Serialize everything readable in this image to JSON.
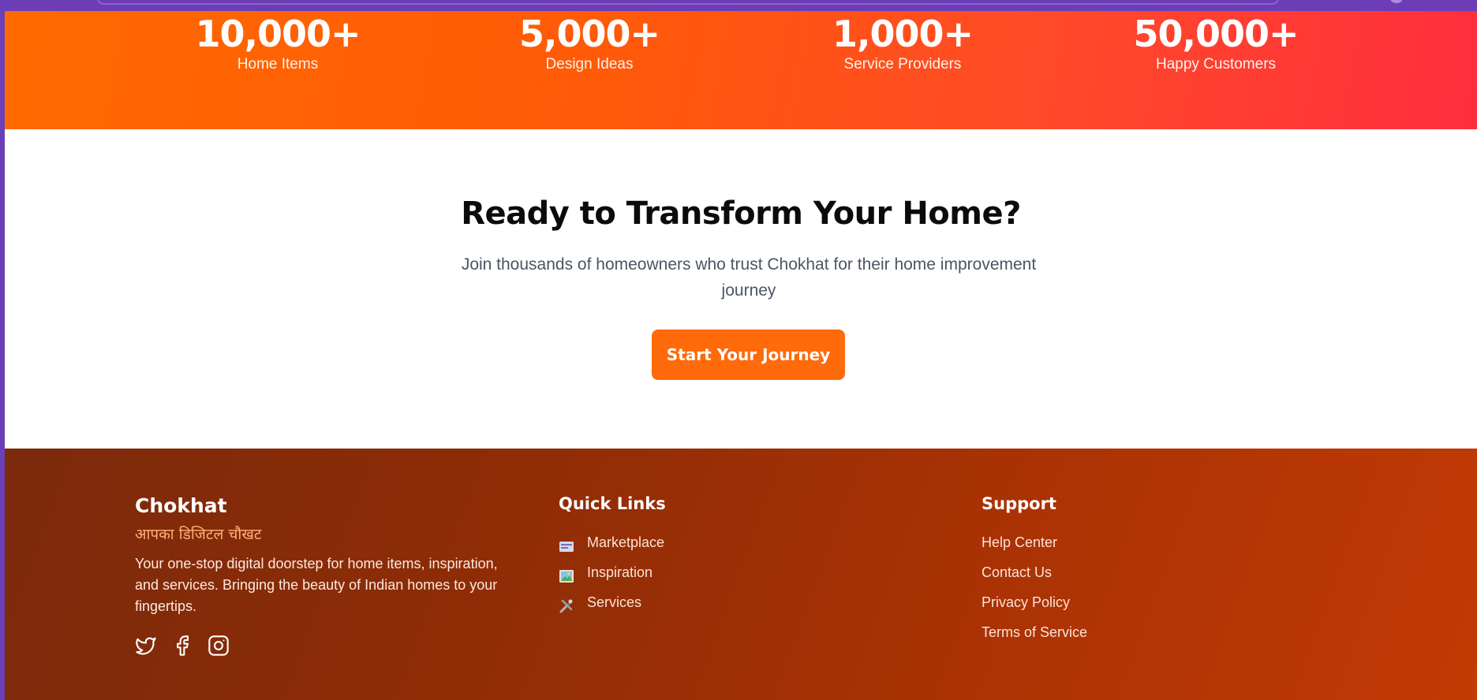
{
  "stats": [
    {
      "value": "10,000+",
      "label": "Home Items"
    },
    {
      "value": "5,000+",
      "label": "Design Ideas"
    },
    {
      "value": "1,000+",
      "label": "Service Providers"
    },
    {
      "value": "50,000+",
      "label": "Happy Customers"
    }
  ],
  "cta": {
    "title": "Ready to Transform Your Home?",
    "subtitle": "Join thousands of homeowners who trust Chokhat for their home improvement journey",
    "button": "Start Your Journey"
  },
  "footer": {
    "brand": {
      "name": "Chokhat",
      "tagline": "आपका डिजिटल चौखट",
      "description": "Your one-stop digital doorstep for home items, inspiration, and services. Bringing the beauty of Indian homes to your fingertips."
    },
    "social_icons": [
      "twitter-icon",
      "facebook-icon",
      "instagram-icon"
    ],
    "quick_links": {
      "title": "Quick Links",
      "items": [
        {
          "label": "Marketplace",
          "icon": "marketplace-icon"
        },
        {
          "label": "Inspiration",
          "icon": "inspiration-icon"
        },
        {
          "label": "Services",
          "icon": "services-icon"
        }
      ]
    },
    "support": {
      "title": "Support",
      "items": [
        "Help Center",
        "Contact Us",
        "Privacy Policy",
        "Terms of Service"
      ]
    }
  },
  "colors": {
    "accent": "#ff6a0b",
    "stats_gradient_start": "#ff6a00",
    "stats_gradient_end": "#ff2e3e",
    "footer_start": "#7b2a0c",
    "footer_end": "#c23a04",
    "tagline": "#ffb27a"
  }
}
